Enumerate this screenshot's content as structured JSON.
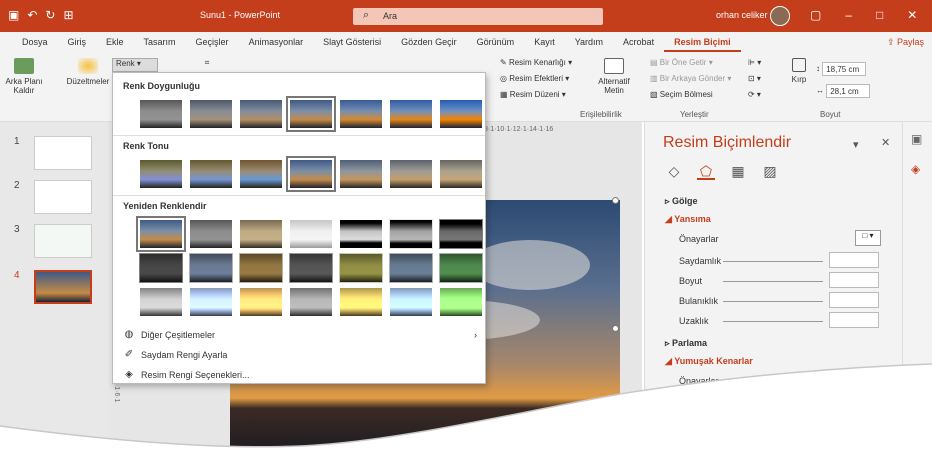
{
  "titlebar": {
    "doc_title": "Sunu1 - PowerPoint",
    "search_placeholder": "Ara",
    "user": "orhan celiker",
    "accent": "#c43e1c"
  },
  "tabs": [
    "Dosya",
    "Giriş",
    "Ekle",
    "Tasarım",
    "Geçişler",
    "Animasyonlar",
    "Slayt Gösterisi",
    "Gözden Geçir",
    "Görünüm",
    "Kayıt",
    "Yardım",
    "Acrobat",
    "Resim Biçimi"
  ],
  "active_tab": "Resim Biçimi",
  "share_label": "Paylaş",
  "ribbon": {
    "remove_bg": "Arka Planı Kaldır",
    "corrections": "Düzeltmeler",
    "color": "Renk",
    "border": "Resim Kenarlığı",
    "effects": "Resim Efektleri",
    "layout": "Resim Düzeni",
    "alt_text": "Alternatif Metin",
    "accessibility": "Erişilebilirlik",
    "bring_forward": "Bir Öne Getir",
    "send_backward": "Bir Arkaya Gönder",
    "selection_pane": "Seçim Bölmesi",
    "arrange": "Yerleştir",
    "crop": "Kırp",
    "height": "18,75 cm",
    "width": "28,1 cm",
    "size": "Boyut"
  },
  "color_menu": {
    "saturation_title": "Renk Doygunluğu",
    "tone_title": "Renk Tonu",
    "recolor_title": "Yeniden Renklendir",
    "more_variations": "Diğer Çeşitlemeler",
    "set_transparent": "Saydam Rengi Ayarla",
    "options": "Resim Rengi Seçenekleri..."
  },
  "slides": [
    "1",
    "2",
    "3",
    "4"
  ],
  "format_pane": {
    "title": "Resim Biçimlendir",
    "shadow": "Gölge",
    "reflection": "Yansıma",
    "presets": "Önayarlar",
    "transparency": "Saydamlık",
    "size": "Boyut",
    "blur": "Bulanıklık",
    "distance": "Uzaklık",
    "glow": "Parlama",
    "soft_edges": "Yumuşak Kenarlar",
    "presets2": "Önayarlar"
  },
  "ruler_h": "8·1·10·1·12·1·14·1·16",
  "ruler_v": "8·1·6·1"
}
